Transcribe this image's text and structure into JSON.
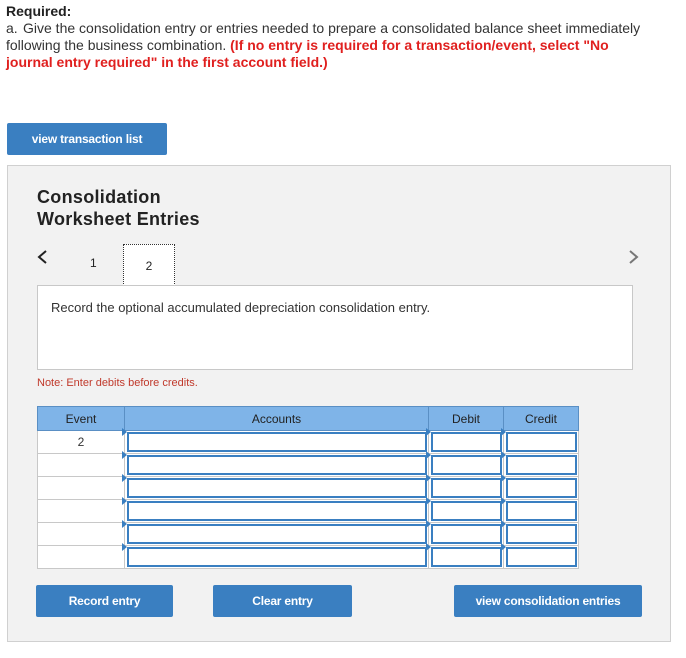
{
  "required": {
    "title": "Required:",
    "label": "a.",
    "text": "Give the consolidation entry or entries needed to prepare a consolidated balance sheet immediately following the business combination.",
    "instruction": "(If no entry is required for a transaction/event, select \"No journal entry required\" in the first account field.)"
  },
  "buttons": {
    "view_transaction_list": "view transaction list",
    "record_entry": "Record entry",
    "clear_entry": "Clear entry",
    "view_consolidation_entries": "view consolidation entries"
  },
  "worksheet": {
    "title_line1": "Consolidation",
    "title_line2": "Worksheet Entries",
    "pages": [
      "1",
      "2"
    ],
    "current_page": "2",
    "prev_icon": "<",
    "next_icon": ">",
    "prompt": "Record the optional accumulated depreciation consolidation entry.",
    "note": "Note: Enter debits before credits."
  },
  "table": {
    "headers": [
      "Event",
      "Accounts",
      "Debit",
      "Credit"
    ],
    "rows": [
      {
        "event": "2",
        "account": "",
        "debit": "",
        "credit": ""
      },
      {
        "event": "",
        "account": "",
        "debit": "",
        "credit": ""
      },
      {
        "event": "",
        "account": "",
        "debit": "",
        "credit": ""
      },
      {
        "event": "",
        "account": "",
        "debit": "",
        "credit": ""
      },
      {
        "event": "",
        "account": "",
        "debit": "",
        "credit": ""
      },
      {
        "event": "",
        "account": "",
        "debit": "",
        "credit": ""
      }
    ]
  },
  "colors": {
    "accent": "#3a7fc1",
    "header_bg": "#7fb4e8",
    "warning_red": "#e0201f"
  }
}
